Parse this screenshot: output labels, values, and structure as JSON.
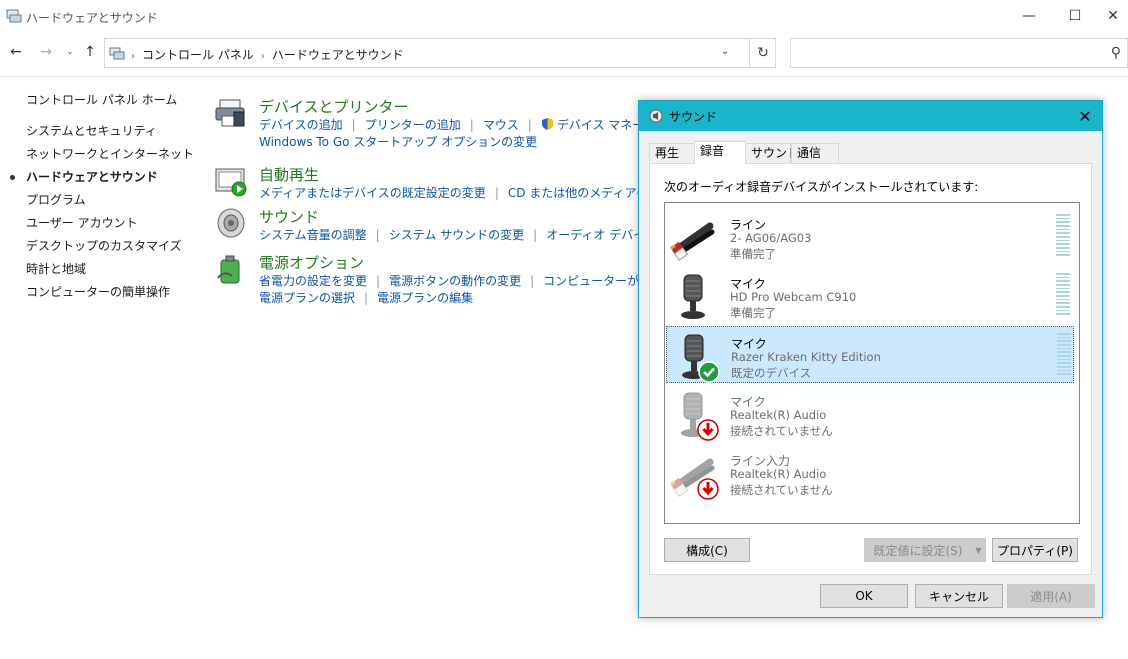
{
  "window": {
    "title": "ハードウェアとサウンド",
    "minimize": "—",
    "maximize": "☐",
    "close": "✕"
  },
  "nav": {
    "back": "←",
    "forward": "→",
    "recent": "⌄",
    "up": "↑",
    "breadcrumb": [
      "コントロール パネル",
      "ハードウェアとサウンド"
    ],
    "breadcrumb_sep": "›",
    "dropdown": "⌄",
    "refresh": "↻",
    "search_placeholder": "",
    "search_glyph": "⚲"
  },
  "sidebar": {
    "home": "コントロール パネル ホーム",
    "items": [
      {
        "label": "システムとセキュリティ",
        "active": false
      },
      {
        "label": "ネットワークとインターネット",
        "active": false
      },
      {
        "label": "ハードウェアとサウンド",
        "active": true
      },
      {
        "label": "プログラム",
        "active": false
      },
      {
        "label": "ユーザー アカウント",
        "active": false
      },
      {
        "label": "デスクトップのカスタマイズ",
        "active": false
      },
      {
        "label": "時計と地域",
        "active": false
      },
      {
        "label": "コンピューターの簡単操作",
        "active": false
      }
    ]
  },
  "categories": [
    {
      "heading": "デバイスとプリンター",
      "icon": "printer-icon",
      "lines": [
        [
          "デバイスの追加",
          "プリンターの追加",
          "マウス",
          "デバイス マネージャー"
        ],
        [
          "Windows To Go スタートアップ オプションの変更"
        ]
      ]
    },
    {
      "heading": "自動再生",
      "icon": "autoplay-icon",
      "lines": [
        [
          "メディアまたはデバイスの既定設定の変更",
          "CD または他のメディアの自動再生"
        ]
      ]
    },
    {
      "heading": "サウンド",
      "icon": "speaker-icon",
      "lines": [
        [
          "システム音量の調整",
          "システム サウンドの変更",
          "オーディオ デバイスの管理"
        ]
      ]
    },
    {
      "heading": "電源オプション",
      "icon": "battery-icon",
      "lines": [
        [
          "省電力の設定を変更",
          "電源ボタンの動作の変更",
          "コンピューターがスリープ状"
        ],
        [
          "電源プランの選択",
          "電源プランの編集"
        ]
      ]
    }
  ],
  "dialog": {
    "title": "サウンド",
    "close": "✕",
    "tabs": [
      {
        "label": "再生",
        "selected": false
      },
      {
        "label": "録音",
        "selected": true
      },
      {
        "label": "サウンド",
        "selected": false
      },
      {
        "label": "通信",
        "selected": false
      }
    ],
    "description": "次のオーディオ録音デバイスがインストールされています:",
    "devices": [
      {
        "name": "ライン",
        "sub": "2- AG06/AG03",
        "status": "準備完了",
        "icon": "line-cable-icon",
        "badge": "",
        "selected": false,
        "disabled": false,
        "level": true
      },
      {
        "name": "マイク",
        "sub": "HD Pro Webcam C910",
        "status": "準備完了",
        "icon": "microphone-icon",
        "badge": "",
        "selected": false,
        "disabled": false,
        "level": true
      },
      {
        "name": "マイク",
        "sub": "Razer Kraken Kitty Edition",
        "status": "既定のデバイス",
        "icon": "microphone-icon",
        "badge": "default-check-icon",
        "selected": true,
        "disabled": false,
        "level": true
      },
      {
        "name": "マイク",
        "sub": "Realtek(R) Audio",
        "status": "接続されていません",
        "icon": "microphone-icon",
        "badge": "unplugged-arrow-icon",
        "selected": false,
        "disabled": true,
        "level": false
      },
      {
        "name": "ライン入力",
        "sub": "Realtek(R) Audio",
        "status": "接続されていません",
        "icon": "line-cable-icon",
        "badge": "unplugged-arrow-icon",
        "selected": false,
        "disabled": true,
        "level": false
      }
    ],
    "buttons": {
      "configure": "構成(C)",
      "set_default": "既定値に設定(S)",
      "set_default_arrow": "▼",
      "properties": "プロパティ(P)",
      "ok": "OK",
      "cancel": "キャンセル",
      "apply": "適用(A)"
    }
  },
  "colors": {
    "link": "#0b55a3",
    "heading": "#1e7a1e",
    "dialog_titlebar": "#1ab5ca",
    "selection": "#cce8ff"
  }
}
